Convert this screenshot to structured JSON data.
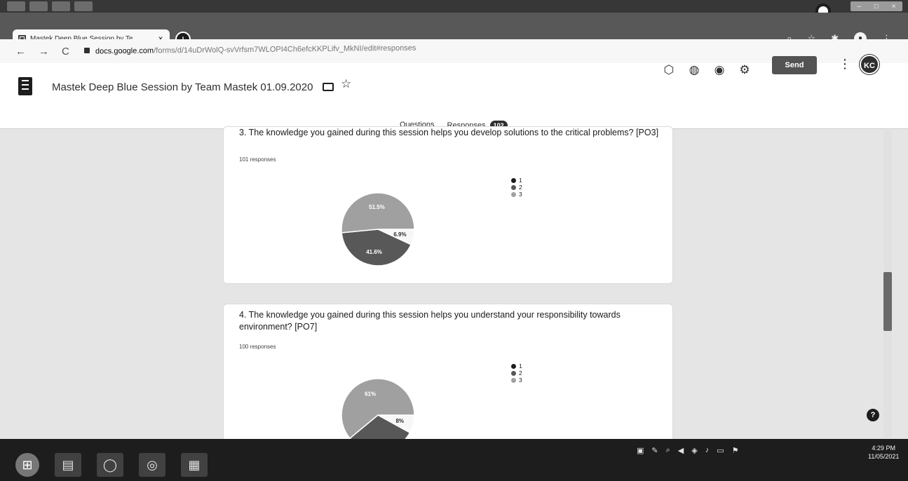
{
  "browser": {
    "tab_title": "Mastek Deep Blue Session by Te",
    "tab_close": "×",
    "new_tab": "+",
    "url_host": "docs.google.com",
    "url_path": "/forms/d/14uDrWolQ-svVrfsm7WLOPI4Ch6efcKKPLifv_MkNI/edit#responses",
    "nav_back": "←",
    "nav_forward": "→",
    "nav_reload": "C",
    "top_icons": [
      "search-icon",
      "star-icon",
      "extensions-icon",
      "account-icon",
      "menu-icon"
    ],
    "window_controls": [
      "–",
      "□",
      "×"
    ]
  },
  "form": {
    "title": "Mastek Deep Blue  Session by Team Mastek 01.09.2020",
    "send_label": "Send",
    "avatar_initials": "KC",
    "tabs": {
      "questions": "Questions",
      "responses": "Responses",
      "responses_count": "102"
    },
    "toolbar_icons": [
      "addon-icon",
      "palette-icon",
      "preview-eye-icon",
      "settings-gear-icon"
    ]
  },
  "cards": [
    {
      "question": "3. The knowledge you gained during this session helps you develop solutions to the critical problems? [PO3]",
      "responses": "101 responses",
      "legend": [
        "1",
        "2",
        "3"
      ],
      "slice_labels": {
        "s3": "51.5%",
        "s2": "41.6%",
        "s1": "6.9%"
      }
    },
    {
      "question": "4. The knowledge you gained during this session helps you understand your responsibility towards environment? [PO7]",
      "responses": "100 responses",
      "legend": [
        "1",
        "2",
        "3"
      ],
      "slice_labels": {
        "s3": "61%",
        "s1": "8%"
      }
    }
  ],
  "chart_data": [
    {
      "type": "pie",
      "title": "3. The knowledge you gained during this session helps you develop solutions to the critical problems? [PO3]",
      "categories": [
        "1",
        "2",
        "3"
      ],
      "values": [
        6.9,
        41.6,
        51.5
      ]
    },
    {
      "type": "pie",
      "title": "4. The knowledge you gained during this session helps you understand your responsibility towards environment? [PO7]",
      "categories": [
        "1",
        "2",
        "3"
      ],
      "values": [
        8,
        31,
        61
      ]
    }
  ],
  "colors": {
    "s1": "#f1f1f1",
    "s2": "#5a5a5a",
    "s3": "#9e9e9e",
    "accent": "#333333"
  },
  "taskbar": {
    "time": "4:29 PM",
    "date": "11/05/2021",
    "tray_icons": [
      "network-icon",
      "volume-icon",
      "battery-icon",
      "flag-icon"
    ]
  },
  "help": "?"
}
